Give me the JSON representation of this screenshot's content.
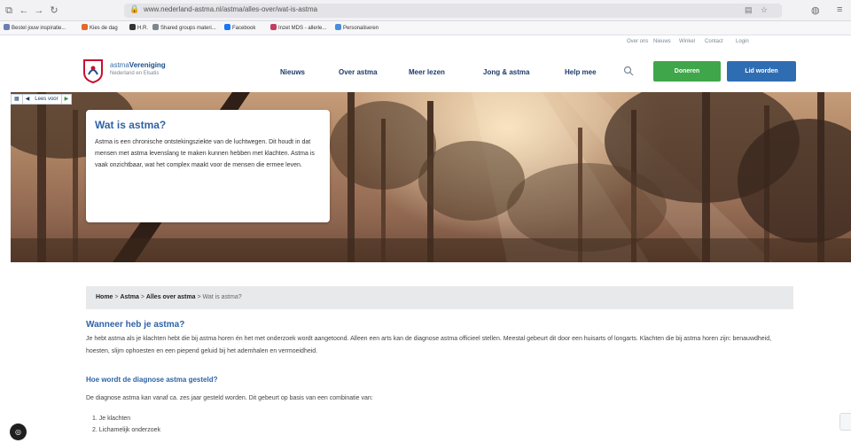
{
  "browser": {
    "url": "www.nederland-astma.nl/astma/alles-over/wat-is-astma",
    "buttons": [
      "back",
      "forward",
      "reload",
      "home"
    ]
  },
  "bookmarks": [
    {
      "label": "Bestel jouw inspiratie...",
      "color": "#6b7fb5"
    },
    {
      "label": "Kies de dag",
      "color": "#e26a2c"
    },
    {
      "label": "H.R.",
      "color": "#333333"
    },
    {
      "label": "Shared groups materi...",
      "color": "#7d8790"
    },
    {
      "label": "Facebook",
      "color": "#1877f2"
    },
    {
      "label": "Inzet MDS - allerle...",
      "color": "#c04060"
    },
    {
      "label": "Personaliseren",
      "color": "#4a8fd6"
    }
  ],
  "utility_links": [
    "Over ons",
    "Nieuws",
    "Winkel",
    "Contact",
    "Login"
  ],
  "site": {
    "logo_prefix": "astma",
    "logo_bold": "Vereniging",
    "logo_sub": "Nederland en Elsatis",
    "nav": [
      "Nieuws",
      "Over astma",
      "Meer lezen",
      "Jong & astma",
      "Help mee"
    ],
    "donate_label": "Doneren",
    "join_label": "Lid worden"
  },
  "read_bar": {
    "label": "Lees voor",
    "play": "▶"
  },
  "hero": {
    "title": "Wat is astma?",
    "text": "Astma is een chronische ontstekingsziekte van de luchtwegen. Dit houdt in dat mensen met astma levenslang te maken kunnen hebben met klachten. Astma is vaak onzichtbaar, wat het complex maakt voor de mensen die ermee leven."
  },
  "breadcrumb": {
    "items": [
      "Home",
      "Astma",
      "Alles over astma"
    ],
    "current": "Wat is astma?",
    "separator": ">"
  },
  "content": {
    "heading": "Wanneer heb je astma?",
    "paragraph": "Je hebt astma als je klachten hebt die bij astma horen én het met onderzoek wordt aangetoond. Alleen een arts kan de diagnose astma officieel stellen. Meestal gebeurt dit door een huisarts of longarts. Klachten die bij astma horen zijn: benauwdheid, hoesten, slijm ophoesten en een piepend geluid bij het ademhalen en vermoeidheid.",
    "subheading": "Hoe wordt de diagnose astma gesteld?",
    "paragraph2": "De diagnose astma kan vanaf ca. zes jaar gesteld worden. Dit gebeurt op basis van een combinatie van:",
    "list": [
      "1. Je klachten",
      "2. Lichamelijk onderzoek"
    ]
  },
  "colors": {
    "brand_blue": "#2f63a7",
    "donate_green": "#3fa64a",
    "join_blue": "#2f6db3"
  }
}
